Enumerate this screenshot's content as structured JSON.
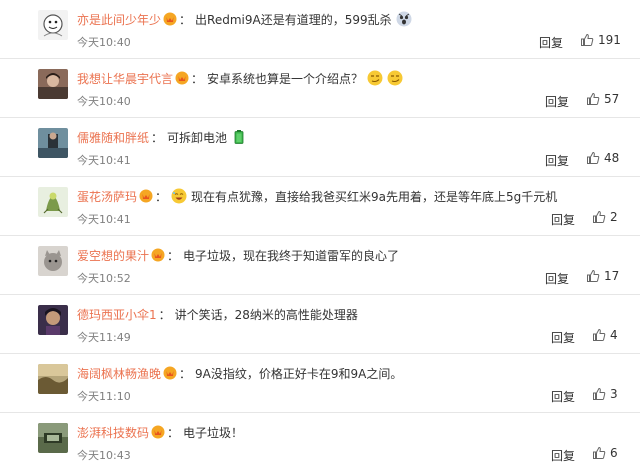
{
  "comments": [
    {
      "username": "亦是此间少年少",
      "text_before": "出Redmi9A还是有道理的，599乱杀",
      "emoji_after": [
        "shocked-face-emoji"
      ],
      "time": "今天10:40",
      "reply_label": "回复",
      "likes": "191"
    },
    {
      "username": "我想让华晨宇代言",
      "text_before": "安卓系统也算是一个介绍点？",
      "emoji_after": [
        "smirk-face-emoji",
        "smirk-face-emoji"
      ],
      "time": "今天10:40",
      "reply_label": "回复",
      "likes": "57"
    },
    {
      "username": "儒雅随和胖纸",
      "text_before": "可拆卸电池",
      "emoji_after": [
        "battery-emoji"
      ],
      "time": "今天10:41",
      "reply_label": "回复",
      "likes": "48"
    },
    {
      "username": "蛋花汤萨玛",
      "emoji_before": "laughing-face-emoji",
      "text_before": "现在有点犹豫，直接给我爸买红米9a先用着，还是等年底上5g千元机",
      "time": "今天10:41",
      "reply_label": "回复",
      "likes": "2"
    },
    {
      "username": "爱空想的果汁",
      "text_before": "电子垃圾，现在我终于知道雷军的良心了",
      "time": "今天10:52",
      "reply_label": "回复",
      "likes": "17"
    },
    {
      "username": "德玛西亚小伞1",
      "text_before": "讲个笑话，28纳米的高性能处理器",
      "time": "今天11:49",
      "reply_label": "回复",
      "likes": "4"
    },
    {
      "username": "海阔枫林畅渔晚",
      "text_before": "9A没指纹，价格正好卡在9和9A之间。",
      "time": "今天11:10",
      "reply_label": "回复",
      "likes": "3"
    },
    {
      "username": "澎湃科技数码",
      "text_before": "电子垃圾！",
      "time": "今天10:43",
      "reply_label": "回复",
      "likes": "6"
    }
  ],
  "colors": {
    "username": "#eb7350",
    "time": "#808080",
    "text": "#333333",
    "divider": "#e6e6e6",
    "badge_gold": "#f5a623",
    "badge_red": "#e8541e"
  }
}
